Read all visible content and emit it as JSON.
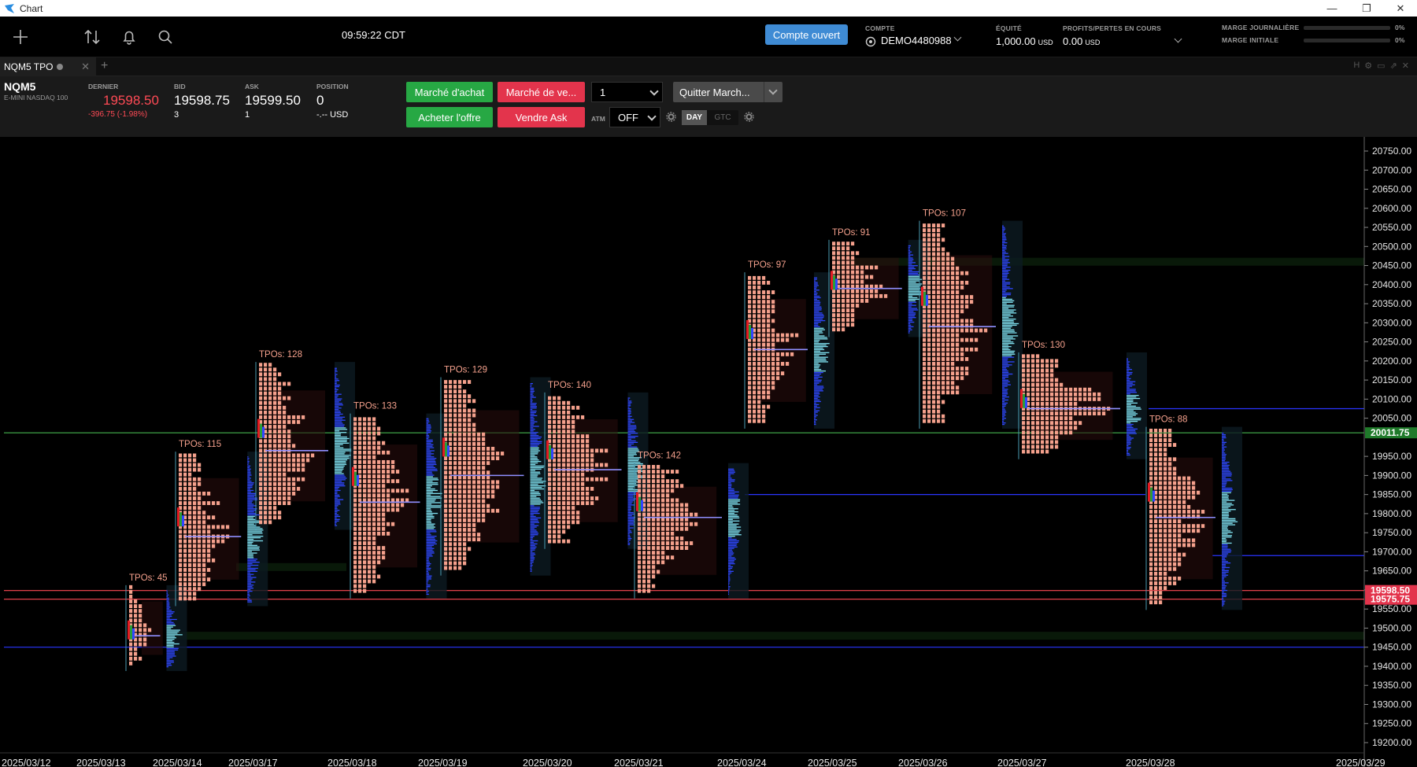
{
  "window": {
    "title": "Chart"
  },
  "toolbar": {
    "clock": "09:59:22 CDT",
    "open_button": "Compte ouvert",
    "account_label": "COMPTE",
    "account_value": "DEMO4480988",
    "equity_label": "ÉQUITÉ",
    "equity_value": "1,000.00",
    "equity_currency": "USD",
    "pnl_label": "PROFITS/PERTES EN COURS",
    "pnl_value": "0.00",
    "pnl_currency": "USD",
    "daily_margin_label": "MARGE JOURNALIÈRE",
    "daily_margin_value": "0%",
    "initial_margin_label": "MARGE INITIALE",
    "initial_margin_value": "0%"
  },
  "tab": {
    "label": "NQM5 TPO"
  },
  "instrument": {
    "symbol": "NQM5",
    "name": "E-MINI NASDAQ 100",
    "last_label": "DERNIER",
    "last_value": "19598.50",
    "last_change": "-396.75 (-1.98%)",
    "bid_label": "BID",
    "bid_value": "19598.75",
    "bid_size": "3",
    "ask_label": "ASK",
    "ask_value": "19599.50",
    "ask_size": "1",
    "position_label": "POSITION",
    "position_value": "0",
    "position_pnl": "-.-- USD"
  },
  "order": {
    "buy_market": "Marché d'achat",
    "sell_market": "Marché de ve...",
    "buy_offer": "Acheter l'offre",
    "sell_ask": "Vendre Ask",
    "quantity": "1",
    "flatten": "Quitter March...",
    "atm_label": "ATM",
    "atm_value": "OFF",
    "tif_day": "DAY",
    "tif_gtc": "GTC"
  },
  "colors": {
    "tpo": "#f4a08c",
    "bull": "#2a9d3a",
    "bear": "#e31b23",
    "volume": "#2f46ff",
    "volume_hi": "#7fe0ef",
    "poc": "#8f8fff",
    "last_price": "#ff4a55",
    "ref_line": "#46b34e"
  },
  "chart_data": {
    "type": "tpo",
    "symbol": "NQM5",
    "y_ticks": [
      20750,
      20700,
      20650,
      20600,
      20550,
      20500,
      20450,
      20400,
      20350,
      20300,
      20250,
      20200,
      20150,
      20100,
      20050,
      19950,
      19900,
      19850,
      19800,
      19750,
      19700,
      19650,
      19600,
      19550,
      19500,
      19450,
      19400,
      19350,
      19300,
      19250,
      19200
    ],
    "ylim": [
      19200,
      20750
    ],
    "dates": [
      "2025/03/12",
      "2025/03/13",
      "2025/03/14",
      "2025/03/17",
      "2025/03/18",
      "2025/03/19",
      "2025/03/20",
      "2025/03/21",
      "2025/03/24",
      "2025/03/25",
      "2025/03/26",
      "2025/03/27",
      "2025/03/28",
      "2025/03/29"
    ],
    "current_price_tag": "20011.75",
    "last_price_tag": "19598.50",
    "low_price_tag": "19575.75",
    "sessions": [
      {
        "date": "2025/03/13",
        "tpos": "TPOs: 45",
        "high": 19600,
        "low": 19400,
        "poc": 19480,
        "max_width": 0.7
      },
      {
        "date": "2025/03/14",
        "tpos": "TPOs: 115",
        "high": 19950,
        "low": 19570,
        "poc": 19740,
        "max_width": 0.75
      },
      {
        "date": "2025/03/17",
        "tpos": "TPOs: 128",
        "high": 20185,
        "low": 19770,
        "poc": 19965,
        "max_width": 0.8
      },
      {
        "date": "2025/03/18",
        "tpos": "TPOs: 133",
        "high": 20050,
        "low": 19590,
        "poc": 19830,
        "max_width": 0.85
      },
      {
        "date": "2025/03/19",
        "tpos": "TPOs: 129",
        "high": 20145,
        "low": 19650,
        "poc": 19900,
        "max_width": 0.85
      },
      {
        "date": "2025/03/20",
        "tpos": "TPOs: 140",
        "high": 20105,
        "low": 19720,
        "poc": 19915,
        "max_width": 0.9
      },
      {
        "date": "2025/03/21",
        "tpos": "TPOs: 142",
        "high": 19920,
        "low": 19590,
        "poc": 19790,
        "max_width": 0.9
      },
      {
        "date": "2025/03/24",
        "tpos": "TPOs: 97",
        "high": 20420,
        "low": 20035,
        "poc": 20230,
        "max_width": 0.8
      },
      {
        "date": "2025/03/25",
        "tpos": "TPOs: 91",
        "high": 20505,
        "low": 20275,
        "poc": 20390,
        "max_width": 0.85
      },
      {
        "date": "2025/03/26",
        "tpos": "TPOs: 107",
        "high": 20555,
        "low": 20035,
        "poc": 20290,
        "max_width": 0.85
      },
      {
        "date": "2025/03/27",
        "tpos": "TPOs: 130",
        "high": 20210,
        "low": 19955,
        "poc": 20075,
        "max_width": 0.9
      },
      {
        "date": "2025/03/28",
        "tpos": "TPOs: 88",
        "high": 20015,
        "low": 19560,
        "poc": 19790,
        "max_width": 0.8
      }
    ],
    "horizontal_lines": [
      {
        "price": 20011.75,
        "color": "#46b34e"
      },
      {
        "price": 19598.5,
        "color": "#ff4a55"
      },
      {
        "price": 19575.75,
        "color": "#ff4a55"
      },
      {
        "price": 19450,
        "color": "#2a35ff"
      },
      {
        "price": 19850,
        "color": "#2a35ff"
      },
      {
        "price": 20075,
        "color": "#2a35ff"
      },
      {
        "price": 19690,
        "color": "#2a35ff"
      }
    ]
  }
}
